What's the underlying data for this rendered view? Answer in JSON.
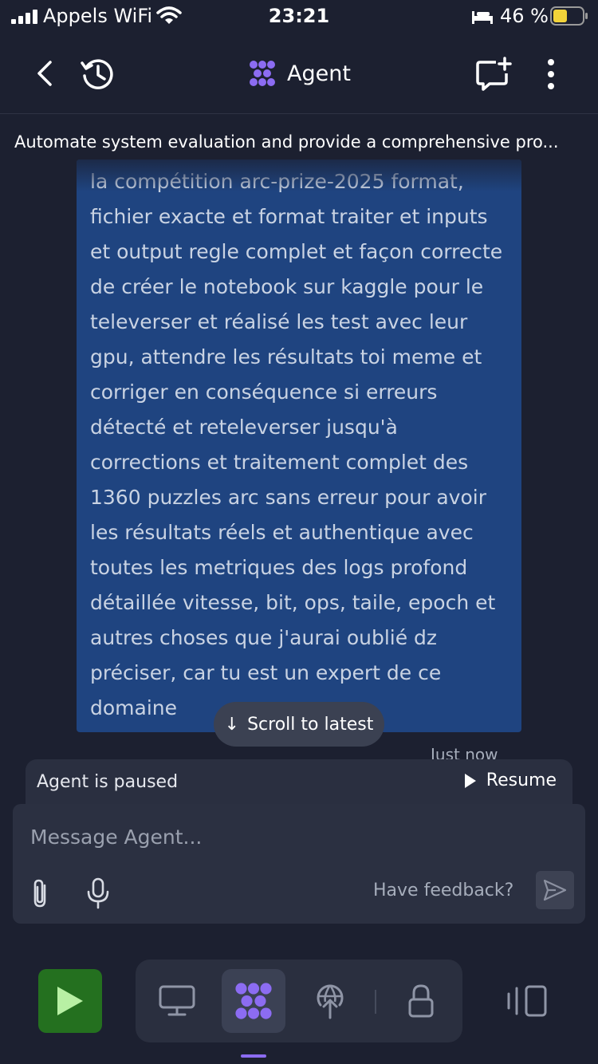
{
  "status_bar": {
    "carrier": "Appels WiFi",
    "time": "23:21",
    "battery_percent": "46 %"
  },
  "header": {
    "title": "Agent"
  },
  "thread": {
    "title": "Automate system evaluation and provide a comprehensive pro..."
  },
  "message": {
    "text": "la compétition arc-prize-2025 format, fichier exacte et format traiter et inputs et output regle complet et façon correcte de créer le notebook sur kaggle pour le televerser et réalisé les test avec leur gpu, attendre les résultats toi meme et corriger en conséquence si erreurs détecté et reteleverser jusqu'à corrections et traitement complet des 1360 puzzles arc sans erreur pour avoir les résultats réels et authentique avec toutes les metriques des logs profond détaillée vitesse, bit, ops, taile, epoch et autres choses que j'aurai oublié dz préciser, car tu est un expert de ce domaine",
    "timestamp": "Just now"
  },
  "scroll_button": {
    "arrow": "↓",
    "label": "Scroll to latest"
  },
  "agent_status": {
    "label": "Agent is paused",
    "resume_label": "Resume"
  },
  "composer": {
    "placeholder": "Message Agent...",
    "feedback_label": "Have feedback?"
  },
  "colors": {
    "background": "#1c2030",
    "bubble": "#1f4480",
    "run_button": "#24701f",
    "accent": "#8c6cf2"
  },
  "icons": {
    "status": [
      "cellular-signal-icon",
      "wifi-icon",
      "bed-icon",
      "battery-icon"
    ],
    "header": [
      "back-icon",
      "history-icon",
      "agent-logo-icon",
      "new-chat-icon",
      "more-icon"
    ],
    "composer": [
      "attach-icon",
      "mic-icon",
      "send-icon"
    ],
    "toolbar": [
      "run-icon",
      "desktop-icon",
      "agent-icon",
      "deploy-icon",
      "lock-icon",
      "panels-icon"
    ]
  }
}
